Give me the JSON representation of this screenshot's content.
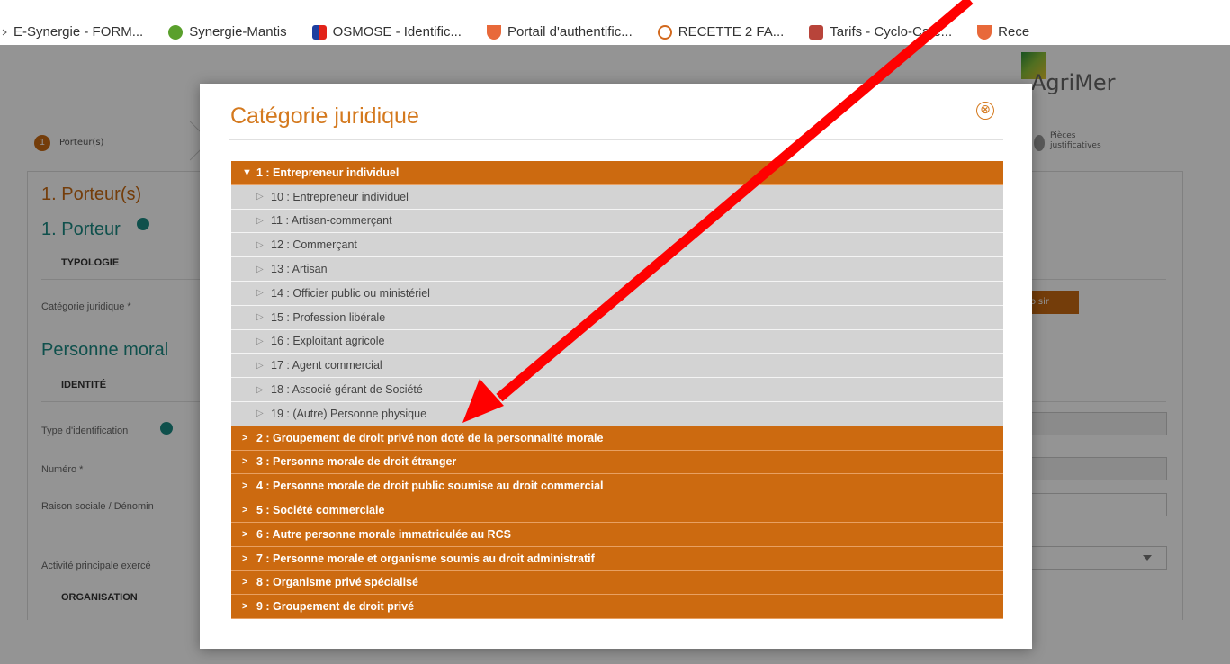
{
  "bookmarks": [
    {
      "label": "E-Synergie - FORM...",
      "icon": "caret-icon"
    },
    {
      "label": "Synergie-Mantis",
      "icon": "mantis-icon"
    },
    {
      "label": "OSMOSE - Identific...",
      "icon": "flag-icon"
    },
    {
      "label": "Portail d'authentific...",
      "icon": "shield-icon"
    },
    {
      "label": "RECETTE 2 FA...",
      "icon": "swirl-icon"
    },
    {
      "label": "Tarifs - Cyclo-Café...",
      "icon": "cafe-icon"
    },
    {
      "label": "Rece",
      "icon": "shield-icon"
    }
  ],
  "background_page": {
    "logo_text": "AgriMer",
    "steps": [
      {
        "number": "1",
        "label": "Porteur(s)"
      },
      {
        "label_line1": "Pièces",
        "label_line2": "justificatives"
      }
    ],
    "section_porteurs": "1. Porteur(s)",
    "section_porteur": "1. Porteur",
    "typologie": "TYPOLOGIE",
    "categorie_label": "Catégorie juridique *",
    "choisir_button": "oisir",
    "personne_morale": "Personne moral",
    "identite": "IDENTITÉ",
    "type_identification_label": "Type d'identification",
    "numero_label": "Numéro *",
    "raison_sociale_label": "Raison sociale / Dénomin",
    "activite_label": "Activité principale exercé",
    "organisation": "ORGANISATION"
  },
  "modal": {
    "title": "Catégorie juridique",
    "close_symbol": "⊗",
    "tree": [
      {
        "level": 1,
        "expanded": true,
        "label": "1 : Entrepreneur individuel"
      },
      {
        "level": 2,
        "label": "10 : Entrepreneur individuel"
      },
      {
        "level": 2,
        "label": "11 : Artisan-commerçant"
      },
      {
        "level": 2,
        "label": "12 : Commerçant"
      },
      {
        "level": 2,
        "label": "13 : Artisan"
      },
      {
        "level": 2,
        "label": "14 : Officier public ou ministériel"
      },
      {
        "level": 2,
        "label": "15 : Profession libérale"
      },
      {
        "level": 2,
        "label": "16 : Exploitant agricole"
      },
      {
        "level": 2,
        "label": "17 : Agent commercial"
      },
      {
        "level": 2,
        "label": "18 : Associé gérant de Société"
      },
      {
        "level": 2,
        "label": "19 : (Autre) Personne physique"
      },
      {
        "level": 1,
        "expanded": false,
        "label": "2 : Groupement de droit privé non doté de la personnalité morale"
      },
      {
        "level": 1,
        "expanded": false,
        "label": "3 : Personne morale de droit étranger"
      },
      {
        "level": 1,
        "expanded": false,
        "label": "4 : Personne morale de droit public soumise au droit commercial"
      },
      {
        "level": 1,
        "expanded": false,
        "label": "5 : Société commerciale"
      },
      {
        "level": 1,
        "expanded": false,
        "label": "6 : Autre personne morale immatriculée au RCS"
      },
      {
        "level": 1,
        "expanded": false,
        "label": "7 : Personne morale et organisme soumis au droit administratif"
      },
      {
        "level": 1,
        "expanded": false,
        "label": "8 : Organisme privé spécialisé"
      },
      {
        "level": 1,
        "expanded": false,
        "label": "9 : Groupement de droit privé"
      }
    ]
  },
  "colors": {
    "accent": "#cc6a10",
    "title": "#d4791e",
    "teal": "#1b8a84",
    "annotation_arrow": "#ff0000"
  }
}
